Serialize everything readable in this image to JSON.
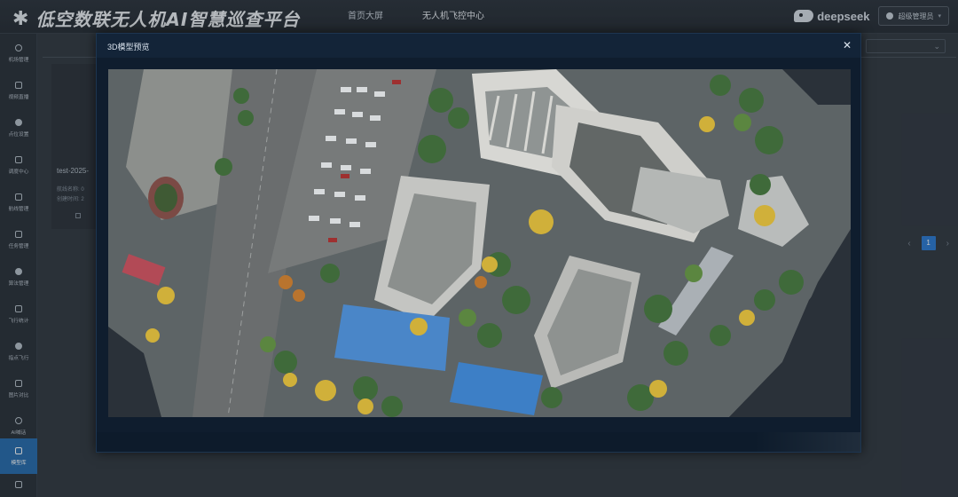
{
  "header": {
    "platform_title": "低空数联无人机AI智慧巡查平台",
    "logo_icon": "drone-icon",
    "nav": [
      {
        "label": "首页大屏",
        "active": false
      },
      {
        "label": "无人机飞控中心",
        "active": true
      }
    ],
    "deepseek_label": "deepseek",
    "user_name": "超级管理员",
    "user_menu_icon": "chevron-down-icon"
  },
  "sidebar": {
    "items": [
      {
        "label": "机场管理",
        "icon": "airport-icon"
      },
      {
        "label": "视频直播",
        "icon": "video-icon"
      },
      {
        "label": "点位设置",
        "icon": "location-pin-icon"
      },
      {
        "label": "调度中心",
        "icon": "dispatch-icon"
      },
      {
        "label": "航线管理",
        "icon": "route-icon"
      },
      {
        "label": "任务管理",
        "icon": "task-icon"
      },
      {
        "label": "算法管理",
        "icon": "algorithm-icon"
      },
      {
        "label": "飞行统计",
        "icon": "stats-icon"
      },
      {
        "label": "指点飞行",
        "icon": "point-flight-icon"
      },
      {
        "label": "图片对比",
        "icon": "image-compare-icon"
      },
      {
        "label": "AI喊话",
        "icon": "microphone-icon"
      },
      {
        "label": "模型库",
        "icon": "model-library-icon",
        "active": true
      },
      {
        "label": "",
        "icon": "logout-icon"
      }
    ]
  },
  "background": {
    "card_title": "test-2025-",
    "card_line1": "航线名称: 0",
    "card_line2": "创建时间: 2",
    "pager_current": "1"
  },
  "modal": {
    "title": "3D模型预览",
    "close_icon": "close-icon"
  },
  "colors": {
    "accent": "#2f7ed6",
    "sidebar_active": "#2a6fb0",
    "modal_bg": "#0f1d2e"
  }
}
